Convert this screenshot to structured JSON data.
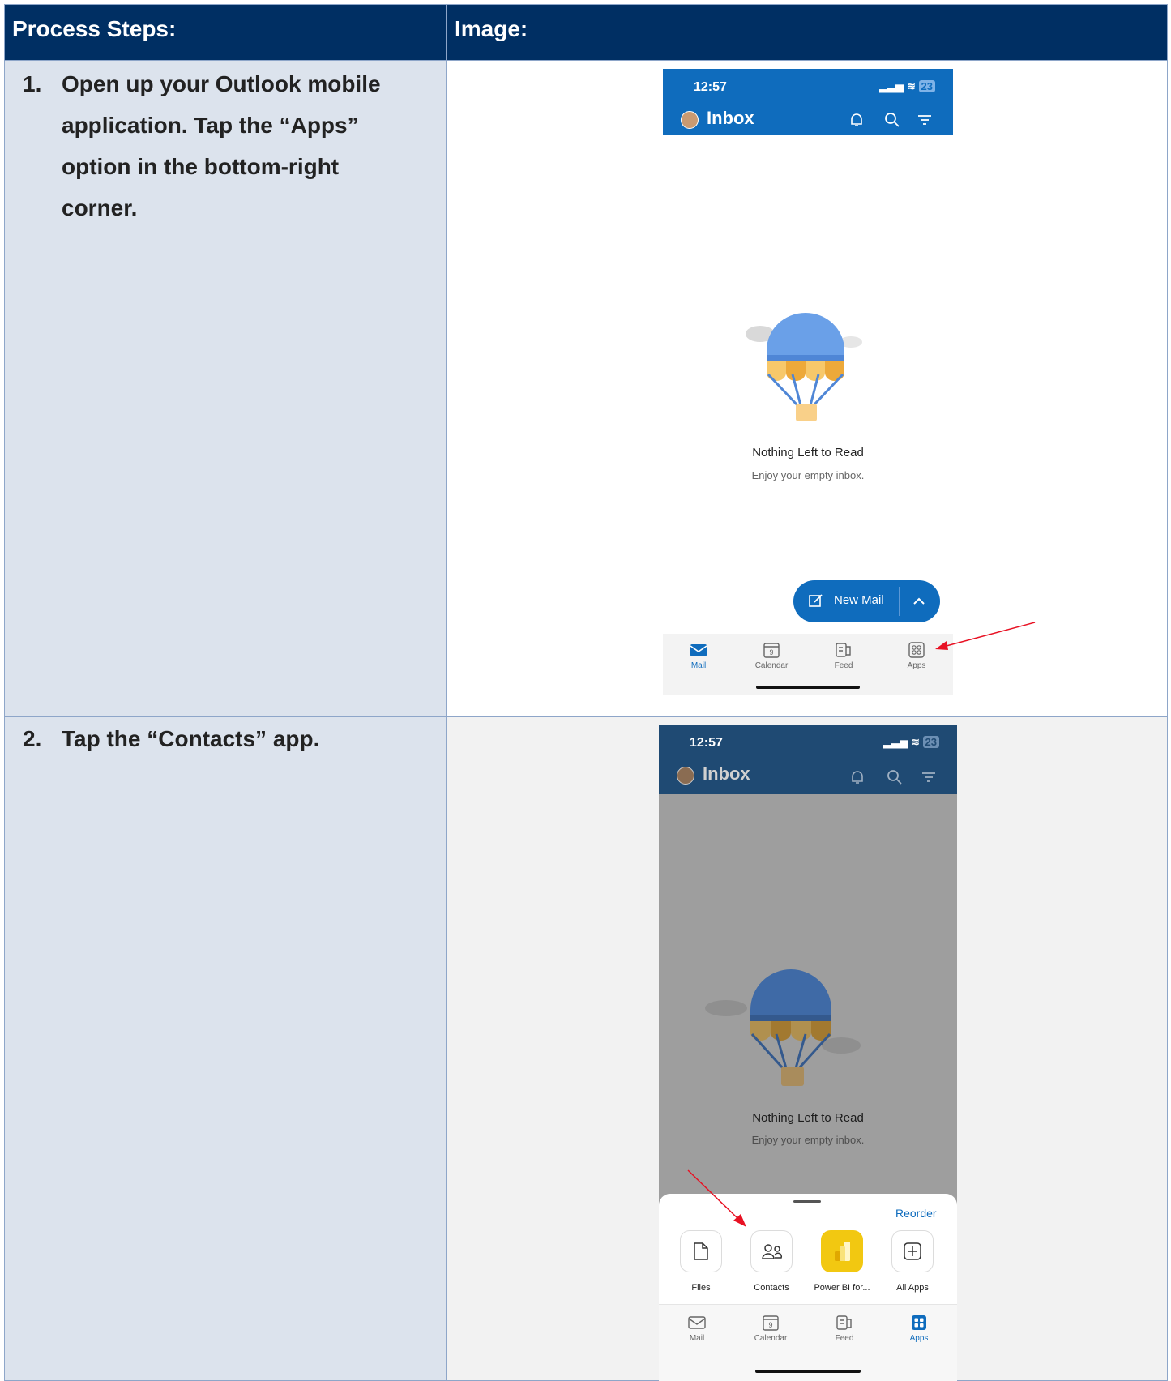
{
  "header": {
    "col1": "Process Steps:",
    "col2": "Image:"
  },
  "steps": [
    {
      "number": "1.",
      "text": "Open up your Outlook mobile application. Tap the “Apps” option in the bottom-right corner."
    },
    {
      "number": "2.",
      "text": "Tap the “Contacts” app."
    }
  ],
  "phone1": {
    "time": "12:57",
    "battery": "23",
    "title": "Inbox",
    "empty_title": "Nothing Left to Read",
    "empty_sub": "Enjoy your empty inbox.",
    "fab_label": "New Mail",
    "tabs": [
      "Mail",
      "Calendar",
      "Feed",
      "Apps"
    ],
    "calendar_day": "9"
  },
  "phone2": {
    "time": "12:57",
    "battery": "23",
    "title": "Inbox",
    "empty_title": "Nothing Left to Read",
    "empty_sub": "Enjoy your empty inbox.",
    "reorder": "Reorder",
    "apps": [
      "Files",
      "Contacts",
      "Power BI for...",
      "All Apps"
    ],
    "tabs": [
      "Mail",
      "Calendar",
      "Feed",
      "Apps"
    ],
    "calendar_day": "9"
  },
  "colors": {
    "header_bg": "#002f63",
    "left_bg": "#dce3ed",
    "outlook_blue": "#0f6cbd",
    "arrow": "#e81123"
  }
}
